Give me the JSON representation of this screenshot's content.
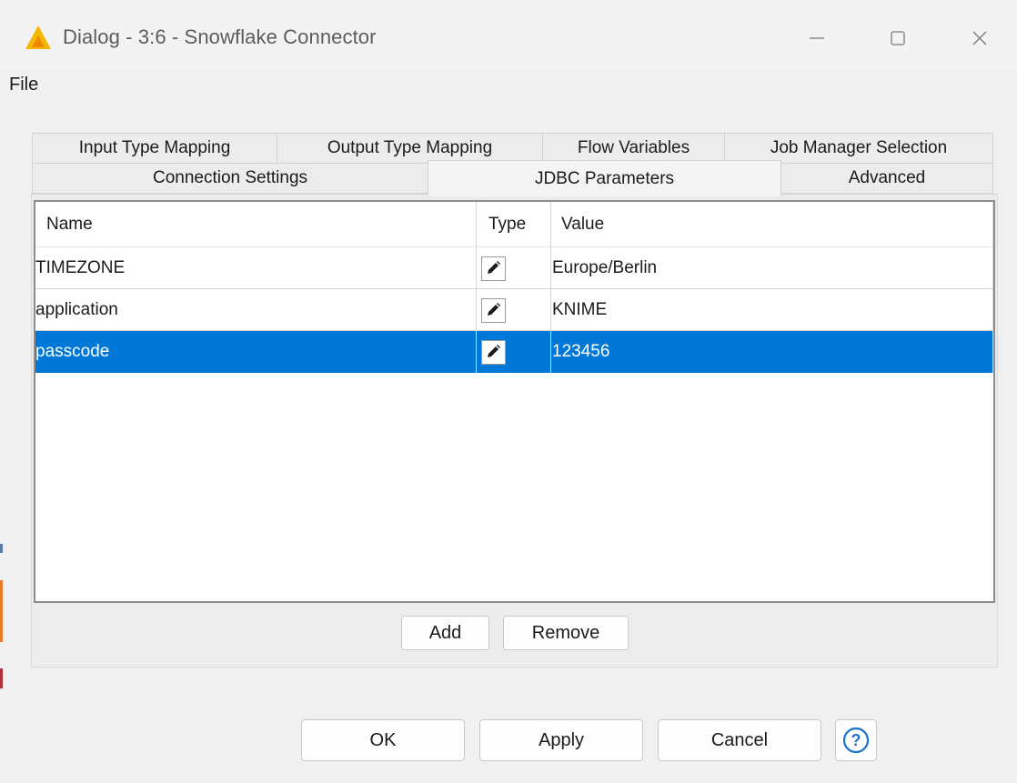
{
  "window": {
    "title": "Dialog - 3:6 - Snowflake Connector",
    "app_icon": "knime-warning-triangle-icon",
    "controls": [
      "minimize-icon",
      "maximize-icon",
      "close-icon"
    ]
  },
  "menu": {
    "file": "File"
  },
  "tabs": {
    "row1": [
      "Input Type Mapping",
      "Output Type Mapping",
      "Flow Variables",
      "Job Manager Selection"
    ],
    "row2": [
      "Connection Settings",
      "JDBC Parameters",
      "Advanced"
    ],
    "active": "JDBC Parameters"
  },
  "table": {
    "headers": {
      "name": "Name",
      "type": "Type",
      "value": "Value"
    },
    "rows": [
      {
        "name": "TIMEZONE",
        "type_icon": "pencil-icon",
        "value": "Europe/Berlin",
        "selected": false
      },
      {
        "name": "application",
        "type_icon": "pencil-icon",
        "value": "KNIME",
        "selected": false
      },
      {
        "name": "passcode",
        "type_icon": "pencil-icon",
        "value": "123456",
        "selected": true
      }
    ]
  },
  "table_buttons": {
    "add": "Add",
    "remove": "Remove"
  },
  "footer": {
    "ok": "OK",
    "apply": "Apply",
    "cancel": "Cancel",
    "help_icon": "help-question-icon"
  },
  "colors": {
    "selection": "#0078d7",
    "app_icon_yellow": "#f5b800",
    "help_blue": "#1874d0"
  }
}
